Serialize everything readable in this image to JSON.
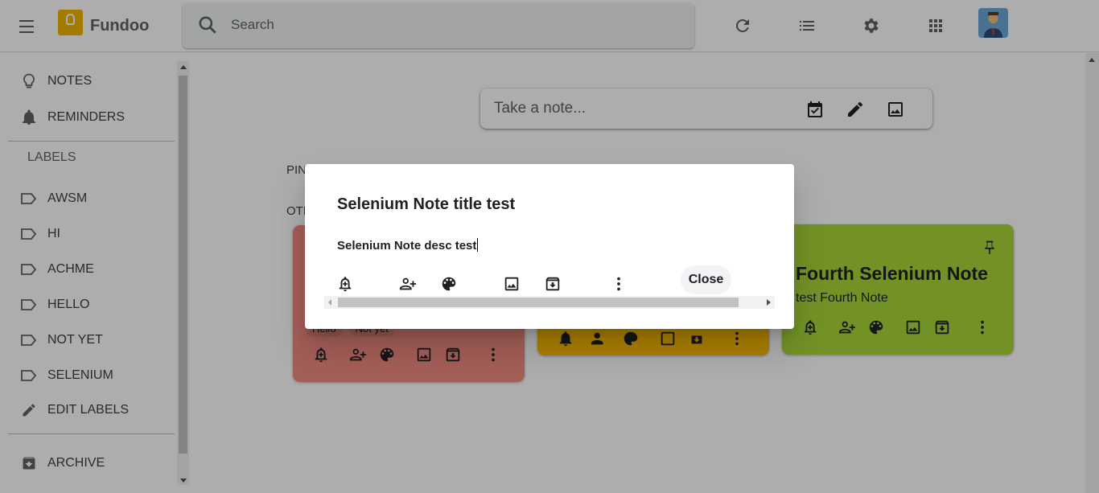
{
  "header": {
    "app_title": "Fundoo",
    "search_placeholder": "Search"
  },
  "sidebar": {
    "items": [
      {
        "label": "NOTES",
        "icon": "lightbulb-icon"
      },
      {
        "label": "REMINDERS",
        "icon": "bell-icon"
      }
    ],
    "labels_heading": "LABELS",
    "labels": [
      "AWSM",
      "HI",
      "ACHME",
      "HELLO",
      "NOT YET",
      "SELENIUM"
    ],
    "edit_labels": "EDIT LABELS",
    "archive": "ARCHIVE"
  },
  "main": {
    "take_note_placeholder": "Take a note...",
    "pinned_label": "PIN",
    "others_label": "OTH",
    "notes": [
      {
        "color": "#f28b82",
        "chips": [
          "Hello",
          "Not yet"
        ]
      },
      {
        "color": "#fbbc04"
      },
      {
        "color": "#a8d738",
        "title": "Fourth Selenium Note",
        "desc": "test Fourth Note"
      }
    ]
  },
  "dialog": {
    "title": "Selenium Note title test",
    "desc": "Selenium Note desc test",
    "close_label": "Close"
  },
  "colors": {
    "overlay": "rgba(0,0,0,0.32)",
    "accent_yellow": "#f4b400"
  }
}
